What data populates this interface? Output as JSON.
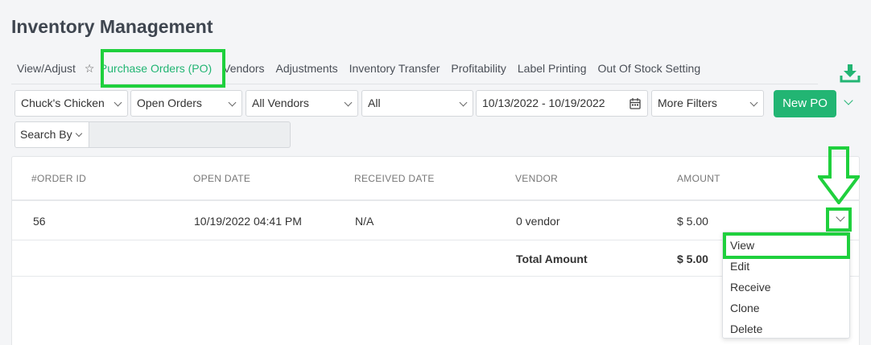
{
  "page": {
    "title": "Inventory Management"
  },
  "tabs": [
    {
      "label": "View/Adjust"
    },
    {
      "label": "Purchase Orders (PO)",
      "active": true
    },
    {
      "label": "Vendors"
    },
    {
      "label": "Adjustments"
    },
    {
      "label": "Inventory Transfer"
    },
    {
      "label": "Profitability"
    },
    {
      "label": "Label Printing"
    },
    {
      "label": "Out Of Stock Setting"
    }
  ],
  "filters": {
    "store": "Chuck's Chicken",
    "status": "Open Orders",
    "vendor": "All Vendors",
    "type": "All",
    "date_range": "10/13/2022 - 10/19/2022",
    "more": "More Filters",
    "new_po": "New PO"
  },
  "search": {
    "by_label": "Search By",
    "value": ""
  },
  "table": {
    "columns": [
      "#ORDER ID",
      "OPEN DATE",
      "RECEIVED DATE",
      "VENDOR",
      "AMOUNT"
    ],
    "rows": [
      {
        "order_id": "56",
        "open_date": "10/19/2022 04:41 PM",
        "received_date": "N/A",
        "vendor": "0 vendor",
        "amount": "$ 5.00"
      }
    ],
    "total": {
      "label": "Total Amount",
      "amount": "$ 5.00"
    }
  },
  "row_menu": [
    "View",
    "Edit",
    "Receive",
    "Clone",
    "Delete"
  ],
  "colors": {
    "accent": "#22b573",
    "highlight": "#1fd03d"
  },
  "icons": [
    "star-icon",
    "download-icon",
    "calendar-icon",
    "chevron-down-icon",
    "annotation-arrow-icon"
  ]
}
